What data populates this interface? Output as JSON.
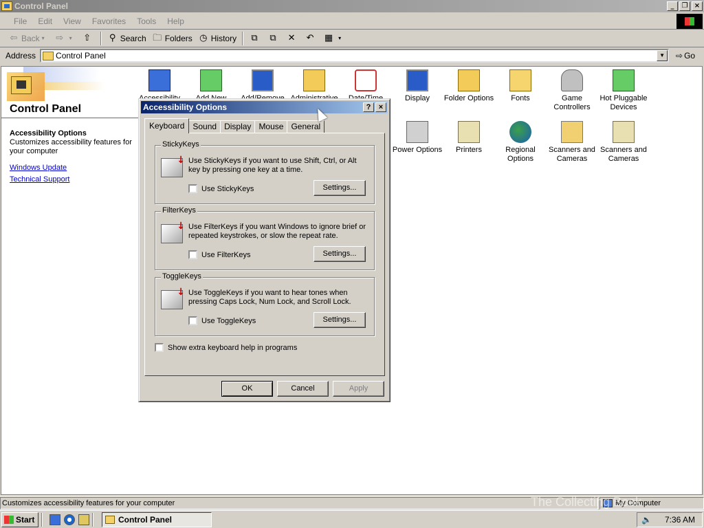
{
  "window": {
    "title": "Control Panel",
    "controls": [
      "minimize",
      "restore",
      "close"
    ]
  },
  "menubar": {
    "items": [
      "File",
      "Edit",
      "View",
      "Favorites",
      "Tools",
      "Help"
    ]
  },
  "toolbar": {
    "back": "Back",
    "search": "Search",
    "folders": "Folders",
    "history": "History"
  },
  "address": {
    "label": "Address",
    "value": "Control Panel",
    "go": "Go"
  },
  "leftpane": {
    "title": "Control Panel",
    "selected_title": "Accessibility Options",
    "selected_desc": "Customizes accessibility features for your computer",
    "links": [
      "Windows Update",
      "Technical Support"
    ]
  },
  "icons": [
    {
      "label": "Accessibility Options",
      "icon": "accessibility-icon"
    },
    {
      "label": "Add New Hardware",
      "icon": "add-hardware-icon"
    },
    {
      "label": "Add/Remove Programs",
      "icon": "add-remove-icon"
    },
    {
      "label": "Administrative Tools",
      "icon": "admin-tools-icon"
    },
    {
      "label": "Date/Time",
      "icon": "date-time-icon"
    },
    {
      "label": "Display",
      "icon": "display-icon"
    },
    {
      "label": "Folder Options",
      "icon": "folder-options-icon"
    },
    {
      "label": "Fonts",
      "icon": "fonts-icon"
    },
    {
      "label": "Game Controllers",
      "icon": "game-controllers-icon"
    },
    {
      "label": "Hot Pluggable Devices",
      "icon": "hot-pluggable-icon"
    },
    {
      "label": "Power Options",
      "icon": "power-options-icon"
    },
    {
      "label": "Printers",
      "icon": "printers-icon"
    },
    {
      "label": "Regional Options",
      "icon": "regional-options-icon"
    },
    {
      "label": "Scanners and Cameras",
      "icon": "scanner-icon"
    },
    {
      "label": "Scanners and Cameras",
      "icon": "scanner-icon"
    }
  ],
  "dialog": {
    "title": "Accessibility Options",
    "help": "?",
    "close": "×",
    "tabs": [
      "Keyboard",
      "Sound",
      "Display",
      "Mouse",
      "General"
    ],
    "active_tab": "Keyboard",
    "groups": [
      {
        "legend": "StickyKeys",
        "text": "Use StickyKeys if you want to use Shift, Ctrl, or Alt key by pressing one key at a time.",
        "checkbox": "Use StickyKeys",
        "checked": false,
        "button": "Settings..."
      },
      {
        "legend": "FilterKeys",
        "text": "Use FilterKeys if you want Windows to ignore brief or repeated keystrokes, or slow the repeat rate.",
        "checkbox": "Use FilterKeys",
        "checked": false,
        "button": "Settings..."
      },
      {
        "legend": "ToggleKeys",
        "text": "Use ToggleKeys if you want to hear tones when pressing Caps Lock, Num Lock, and Scroll Lock.",
        "checkbox": "Use ToggleKeys",
        "checked": false,
        "button": "Settings..."
      }
    ],
    "extra_help": "Show extra keyboard help in programs",
    "ok": "OK",
    "cancel": "Cancel",
    "apply": "Apply"
  },
  "statusbar": {
    "text": "Customizes accessibility features for your computer",
    "zone": "My Computer"
  },
  "taskbar": {
    "start": "Start",
    "task": "Control Panel",
    "time": "7:36 AM"
  },
  "watermark": "The Collecting Book"
}
